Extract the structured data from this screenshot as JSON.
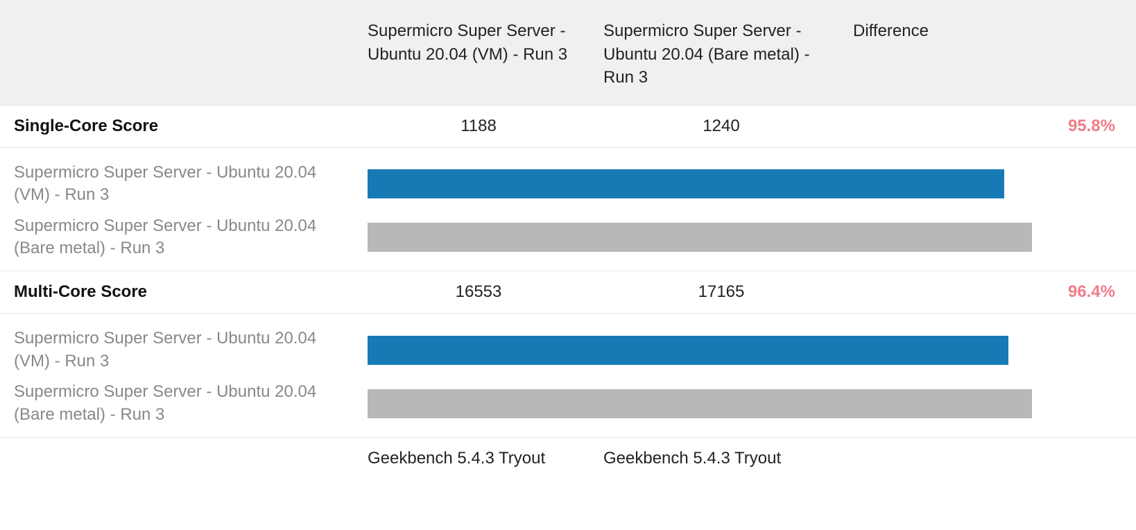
{
  "header": {
    "col_a": "Supermicro Super Server - Ubuntu 20.04 (VM) - Run 3",
    "col_b": "Supermicro Super Server - Ubuntu 20.04 (Bare metal) - Run 3",
    "col_diff": "Difference"
  },
  "single": {
    "label": "Single-Core Score",
    "value_a": "1188",
    "value_b": "1240",
    "diff": "95.8%",
    "bar_a_label": "Supermicro Super Server - Ubuntu 20.04 (VM) - Run 3",
    "bar_b_label": "Supermicro Super Server - Ubuntu 20.04 (Bare metal) - Run 3"
  },
  "multi": {
    "label": "Multi-Core Score",
    "value_a": "16553",
    "value_b": "17165",
    "diff": "96.4%",
    "bar_a_label": "Supermicro Super Server - Ubuntu 20.04 (VM) - Run 3",
    "bar_b_label": "Supermicro Super Server - Ubuntu 20.04 (Bare metal) - Run 3"
  },
  "footer": {
    "col_a": "Geekbench 5.4.3 Tryout",
    "col_b": "Geekbench 5.4.3 Tryout"
  },
  "chart_data": [
    {
      "type": "bar",
      "title": "Single-Core Score",
      "categories": [
        "Supermicro Super Server - Ubuntu 20.04 (VM) - Run 3",
        "Supermicro Super Server - Ubuntu 20.04 (Bare metal) - Run 3"
      ],
      "values": [
        1188,
        1240
      ],
      "difference_pct": 95.8
    },
    {
      "type": "bar",
      "title": "Multi-Core Score",
      "categories": [
        "Supermicro Super Server - Ubuntu 20.04 (VM) - Run 3",
        "Supermicro Super Server - Ubuntu 20.04 (Bare metal) - Run 3"
      ],
      "values": [
        16553,
        17165
      ],
      "difference_pct": 96.4
    }
  ],
  "colors": {
    "bar_primary": "#177ab4",
    "bar_secondary": "#b8b8b8",
    "diff_text": "#ef7d88"
  }
}
